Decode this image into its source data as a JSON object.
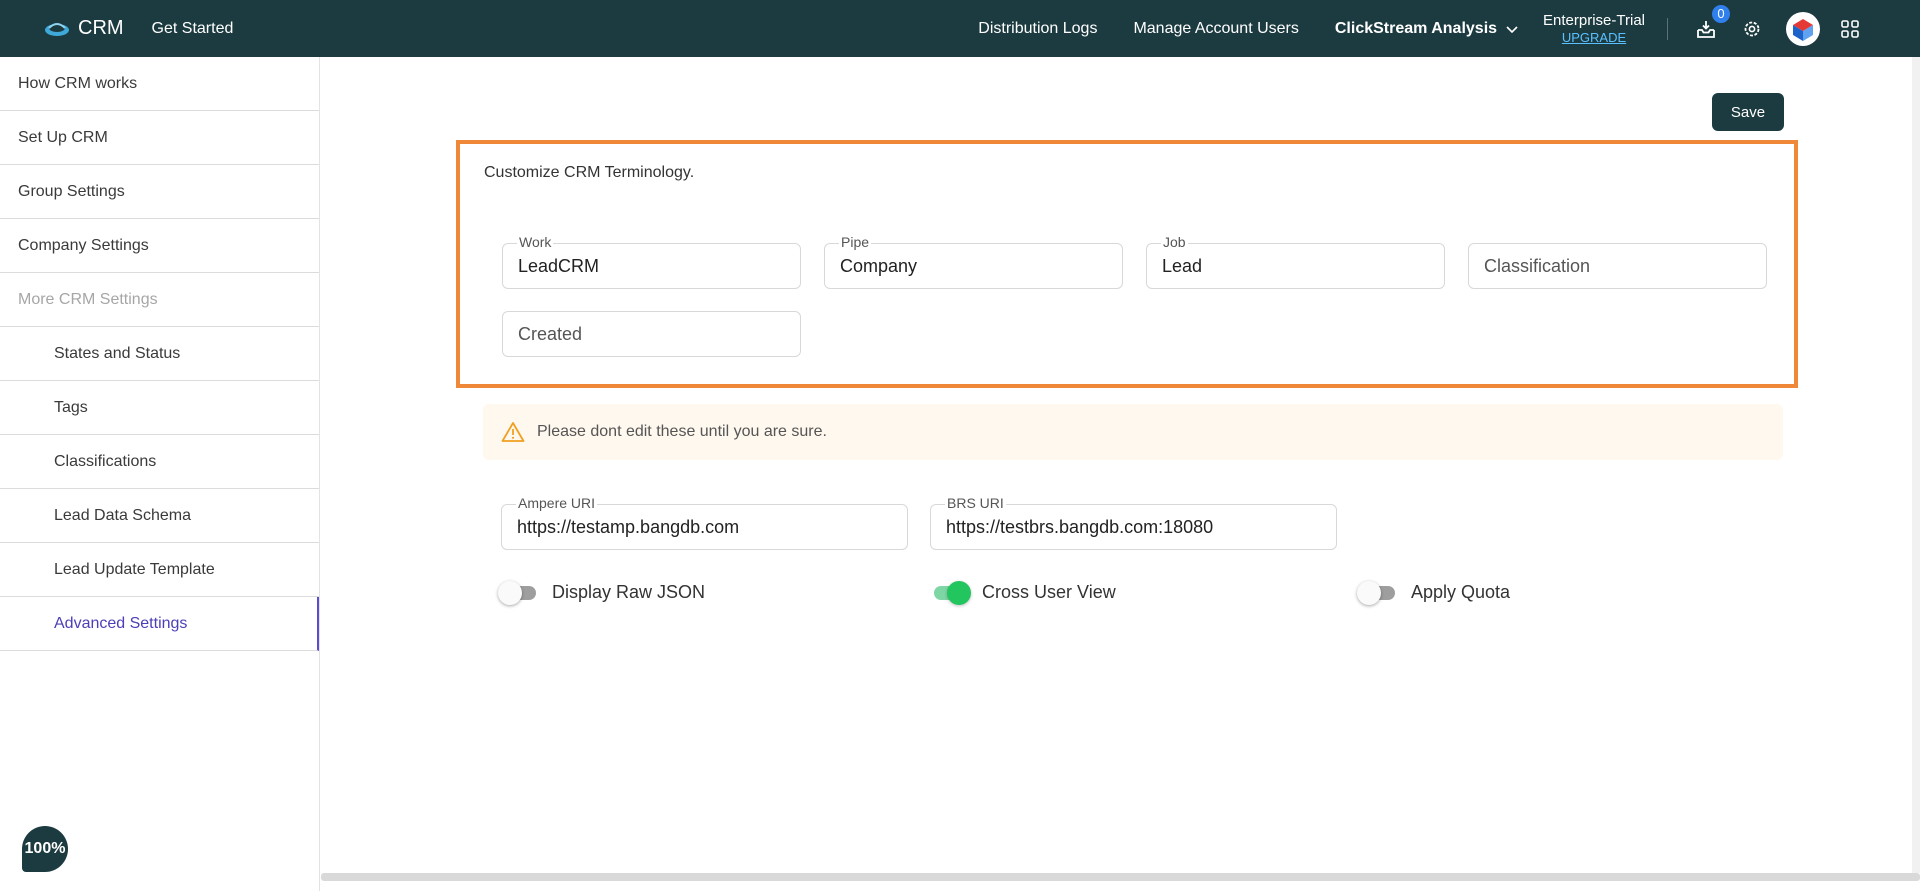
{
  "topbar": {
    "brand": "CRM",
    "get_started": "Get Started",
    "nav": [
      "Distribution Logs",
      "Manage Account Users"
    ],
    "analysis": "ClickStream Analysis",
    "plan_name": "Enterprise-Trial",
    "plan_upgrade": "UPGRADE",
    "notification_count": "0",
    "icons": [
      "inbox-icon",
      "gear-icon",
      "avatar",
      "apps-grid-icon"
    ]
  },
  "sidebar": {
    "items": [
      "How CRM works",
      "Set Up CRM",
      "Group Settings",
      "Company Settings",
      "More CRM Settings",
      "States and Status",
      "Tags",
      "Classifications",
      "Lead Data Schema",
      "Lead Update Template",
      "Advanced Settings"
    ],
    "active_item": "Advanced Settings",
    "zoom": "100%"
  },
  "main": {
    "save_label": "Save",
    "terminology": {
      "title": "Customize CRM Terminology.",
      "fields": [
        {
          "label": "Work",
          "value": "LeadCRM"
        },
        {
          "label": "Pipe",
          "value": "Company"
        },
        {
          "label": "Job",
          "value": "Lead"
        },
        {
          "label": "",
          "value": "",
          "placeholder": "Classification"
        },
        {
          "label": "",
          "value": "",
          "placeholder": "Created"
        }
      ]
    },
    "warning_text": "Please dont edit these until you are sure.",
    "uris": [
      {
        "label": "Ampere URI",
        "value": "https://testamp.bangdb.com"
      },
      {
        "label": "BRS URI",
        "value": "https://testbrs.bangdb.com:18080"
      }
    ],
    "toggles": [
      {
        "label": "Display Raw JSON",
        "on": false
      },
      {
        "label": "Cross User View",
        "on": true
      },
      {
        "label": "Apply Quota",
        "on": false
      }
    ]
  },
  "colors": {
    "topbar": "#1c3b40",
    "highlight_border": "#f0883a",
    "active_nav": "#4b3fb8",
    "toggle_on": "#22c55e",
    "badge": "#2f80ed"
  }
}
